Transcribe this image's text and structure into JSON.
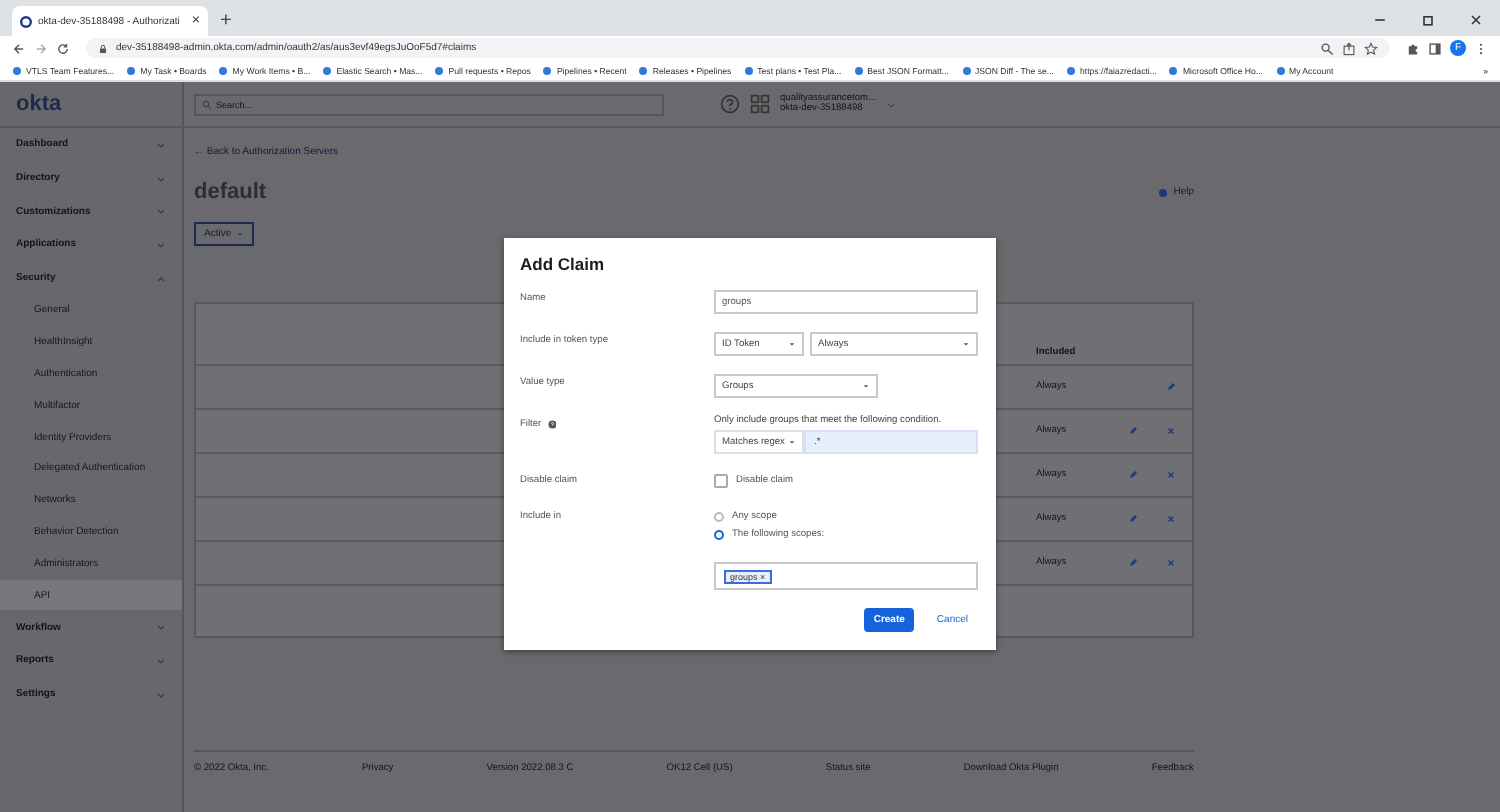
{
  "browser": {
    "tab": {
      "title": "okta-dev-35188498 - Authorizati",
      "close": "×"
    },
    "new_tab": "+",
    "url": "dev-35188498-admin.okta.com/admin/oauth2/as/aus3evf49egsJuOoF5d7#claims",
    "profile": "F",
    "bookmarks": [
      "VTLS Team Features...",
      "My Task • Boards",
      "My Work Items • B...",
      "Elastic Search • Mas...",
      "Pull requests • Repos",
      "Pipelines • Recent",
      "Releases • Pipelines",
      "Test plans • Test Pla...",
      "Best JSON Formatt...",
      "JSON Diff - The se...",
      "https://faiazredacti...",
      "Microsoft Office Ho...",
      "My Account"
    ],
    "bookmarks_more": "»"
  },
  "logo": "okta",
  "header": {
    "search": {
      "placeholder": "Search..."
    },
    "user": {
      "name": "qualityassurancetom...",
      "org": "okta-dev-35188498"
    }
  },
  "sidebar": {
    "items": [
      {
        "label": "Dashboard",
        "expanded": false
      },
      {
        "label": "Directory",
        "expanded": false
      },
      {
        "label": "Customizations",
        "expanded": false
      },
      {
        "label": "Applications",
        "expanded": false
      },
      {
        "label": "Security",
        "expanded": true,
        "children": [
          {
            "label": "General",
            "selected": false
          },
          {
            "label": "HealthInsight",
            "selected": false
          },
          {
            "label": "Authentication",
            "selected": false
          },
          {
            "label": "Multifactor",
            "selected": false
          },
          {
            "label": "Identity Providers",
            "selected": false
          },
          {
            "label": "Delegated Authentication",
            "selected": false
          },
          {
            "label": "Networks",
            "selected": false
          },
          {
            "label": "Behavior Detection",
            "selected": false
          },
          {
            "label": "Administrators",
            "selected": false
          },
          {
            "label": "API",
            "selected": true
          }
        ]
      },
      {
        "label": "Workflow",
        "expanded": false
      },
      {
        "label": "Reports",
        "expanded": false
      },
      {
        "label": "Settings",
        "expanded": false
      }
    ]
  },
  "page": {
    "back_link": "← Back to Authorization Servers",
    "title": "default",
    "help": "Help",
    "status_button": "Active",
    "table": {
      "columns": [
        {
          "label": "Included"
        }
      ],
      "rows": [
        {
          "included": "Always",
          "deletable": false
        },
        {
          "included": "Always",
          "deletable": true
        },
        {
          "included": "Always",
          "deletable": true
        },
        {
          "included": "Always",
          "deletable": true
        },
        {
          "included": "Always",
          "deletable": true
        }
      ]
    }
  },
  "footer": [
    "© 2022 Okta, Inc.",
    "Privacy",
    "Version 2022.08.3 C",
    "OK12 Cell (US)",
    "Status site",
    "Download Okta Plugin",
    "Feedback"
  ],
  "dialog": {
    "title": "Add Claim",
    "fields": [
      {
        "kind": "text",
        "label": "Name",
        "value": "groups"
      },
      {
        "kind": "select_pair",
        "label": "Include in token type",
        "values": [
          "ID Token",
          "Always"
        ]
      },
      {
        "kind": "select",
        "label": "Value type",
        "value": "Groups"
      },
      {
        "kind": "filter",
        "label": "Filter",
        "hint": "Only include groups that meet the following condition.",
        "operator": "Matches regex",
        "value": ".*"
      },
      {
        "kind": "checkbox",
        "label": "Disable claim",
        "option": "Disable claim",
        "checked": false
      },
      {
        "kind": "radio",
        "label": "Include in",
        "options": [
          {
            "label": "Any scope",
            "selected": false
          },
          {
            "label": "The following scopes:",
            "selected": true
          }
        ],
        "tags": [
          {
            "label": "groups",
            "remove": "×"
          }
        ]
      }
    ],
    "buttons": [
      {
        "label": "Create",
        "kind": "primary"
      },
      {
        "label": "Cancel",
        "kind": "link"
      }
    ]
  }
}
